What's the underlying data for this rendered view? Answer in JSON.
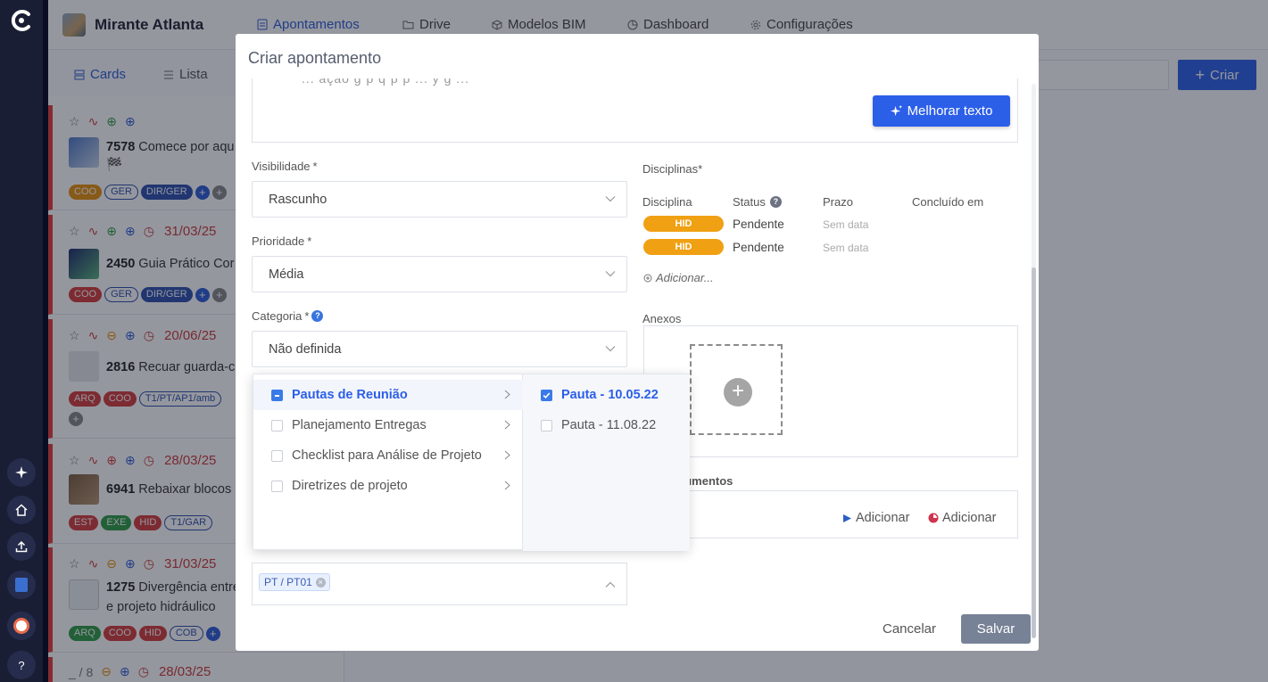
{
  "project": {
    "name": "Mirante Atlanta"
  },
  "nav": {
    "tabs": [
      {
        "label": "Apontamentos"
      },
      {
        "label": "Drive"
      },
      {
        "label": "Modelos BIM"
      },
      {
        "label": "Dashboard"
      },
      {
        "label": "Configurações"
      }
    ]
  },
  "views": {
    "cards": "Cards",
    "lista": "Lista"
  },
  "header": {
    "create_label": "Criar"
  },
  "cards": [
    {
      "id": "7578",
      "title": "Comece por aqu",
      "extra": "🏁",
      "date": "",
      "tags": [
        "COO",
        "GER",
        "DIR/GER"
      ]
    },
    {
      "id": "2450",
      "title": "Guia Prático Cor",
      "extra": "",
      "date": "31/03/25",
      "tags": [
        "COO",
        "GER",
        "DIR/GER"
      ]
    },
    {
      "id": "2816",
      "title": "Recuar guarda-c",
      "extra": "",
      "date": "20/06/25",
      "tags": [
        "ARQ",
        "COO",
        "T1/PT/AP1/amb"
      ]
    },
    {
      "id": "6941",
      "title": "Rebaixar blocos",
      "extra": "",
      "date": "28/03/25",
      "tags": [
        "EST",
        "EXE",
        "HID",
        "T1/GAR"
      ]
    },
    {
      "id": "1275",
      "title": "Divergência entre",
      "extra": "e projeto hidráulico",
      "date": "31/03/25",
      "tags": [
        "ARQ",
        "COO",
        "HID",
        "COB"
      ]
    },
    {
      "id": "_ / 8",
      "title": "",
      "extra": "",
      "date": "28/03/25",
      "tags": []
    }
  ],
  "modal": {
    "title": "Criar apontamento",
    "textarea_clip": "... ação g  p  q  p    p ... y     g ...",
    "improve_button": "Melhorar texto",
    "visibilidade": {
      "label": "Visibilidade",
      "req": "*",
      "value": "Rascunho"
    },
    "prioridade": {
      "label": "Prioridade",
      "req": "*",
      "value": "Média"
    },
    "categoria": {
      "label": "Categoria",
      "req": "*",
      "help": "?",
      "value": "Não definida"
    },
    "disciplinas": {
      "label": "Disciplinas*",
      "headers": {
        "disciplina": "Disciplina",
        "status": "Status",
        "status_help": "?",
        "prazo": "Prazo",
        "concluido": "Concluído em"
      },
      "rows": [
        {
          "disc": "HID",
          "status": "Pendente",
          "prazo": "Sem data"
        },
        {
          "disc": "HID",
          "status": "Pendente",
          "prazo": "Sem data"
        }
      ],
      "add_label": "Adicionar..."
    },
    "anexos": {
      "label": "Anexos",
      "add": "+"
    },
    "documentos": {
      "label": "Documentos",
      "label_visible": "cumentos",
      "add1": "Adicionar",
      "add2": "Adicionar"
    },
    "pavimento": {
      "chip": "PT / PT01"
    },
    "cancel": "Cancelar",
    "save": "Salvar"
  },
  "cascader": {
    "level1": [
      {
        "label": "Pautas de Reunião",
        "state": "indeterminate",
        "active": true
      },
      {
        "label": "Planejamento Entregas",
        "state": "unchecked"
      },
      {
        "label": "Checklist para Análise de Projeto",
        "state": "unchecked"
      },
      {
        "label": "Diretrizes de projeto",
        "state": "unchecked"
      }
    ],
    "level2": [
      {
        "label": "Pauta - 10.05.22",
        "state": "checked"
      },
      {
        "label": "Pauta - 11.08.22",
        "state": "unchecked"
      }
    ]
  },
  "rail": {
    "help": "?"
  },
  "colors": {
    "primary": "#2c5fe8",
    "accent_red": "#e23d3d",
    "pill_orange": "#f0a013",
    "rail": "#1a1e35"
  }
}
